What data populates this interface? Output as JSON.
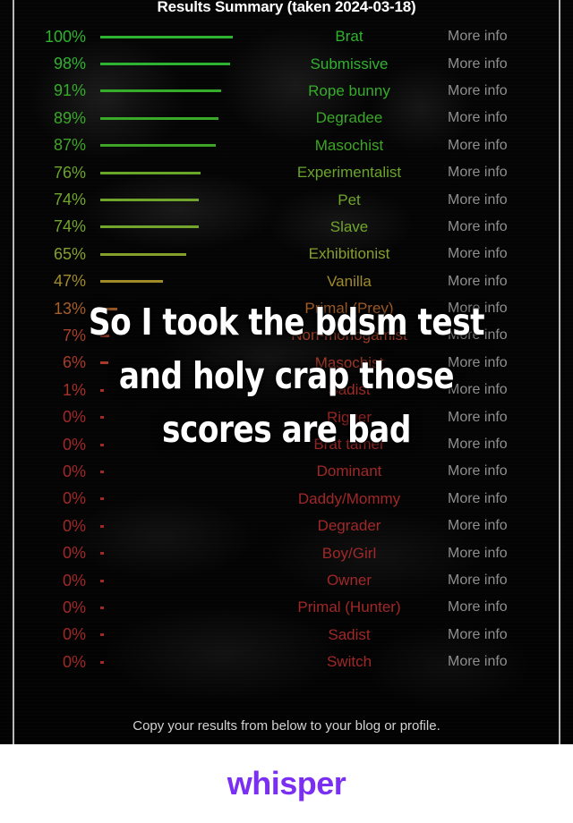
{
  "app": {
    "name": "whisper",
    "wordmark": "whisper",
    "wordmark_color": "#7a2ff2"
  },
  "results": {
    "title": "Results Summary (taken 2024-03-18)",
    "footer_note": "Copy your results from below to your blog or profile.",
    "more_info_label": "More info",
    "columns": [
      "percent",
      "bar",
      "category",
      "more_info"
    ],
    "rows": [
      {
        "percent": "100%",
        "value": 100,
        "label": "Brat",
        "color": "#2fb22f",
        "more_info": "More info"
      },
      {
        "percent": "98%",
        "value": 98,
        "label": "Submissive",
        "color": "#2fb22f",
        "more_info": "More info"
      },
      {
        "percent": "91%",
        "value": 91,
        "label": "Rope bunny",
        "color": "#35ad2a",
        "more_info": "More info"
      },
      {
        "percent": "89%",
        "value": 89,
        "label": "Degradee",
        "color": "#3aa828",
        "more_info": "More info"
      },
      {
        "percent": "87%",
        "value": 87,
        "label": "Masochist",
        "color": "#3fa526",
        "more_info": "More info"
      },
      {
        "percent": "76%",
        "value": 76,
        "label": "Experimentalist",
        "color": "#6aa52a",
        "more_info": "More info"
      },
      {
        "percent": "74%",
        "value": 74,
        "label": "Pet",
        "color": "#71a52c",
        "more_info": "More info"
      },
      {
        "percent": "74%",
        "value": 74,
        "label": "Slave",
        "color": "#71a52c",
        "more_info": "More info"
      },
      {
        "percent": "65%",
        "value": 65,
        "label": "Exhibitionist",
        "color": "#86a02d",
        "more_info": "More info"
      },
      {
        "percent": "47%",
        "value": 47,
        "label": "Vanilla",
        "color": "#a08b2b",
        "more_info": "More info"
      },
      {
        "percent": "13%",
        "value": 13,
        "label": "Primal (Prey)",
        "color": "#a85f28",
        "more_info": "More info"
      },
      {
        "percent": "7%",
        "value": 7,
        "label": "Non-monogamist",
        "color": "#a8402a",
        "more_info": "More info"
      },
      {
        "percent": "6%",
        "value": 6,
        "label": "Masochist",
        "color": "#a83a2a",
        "more_info": "More info"
      },
      {
        "percent": "1%",
        "value": 1,
        "label": "Sadist",
        "color": "#a8302a",
        "more_info": "More info"
      },
      {
        "percent": "0%",
        "value": 0,
        "label": "Rigger",
        "color": "#a02828",
        "more_info": "More info"
      },
      {
        "percent": "0%",
        "value": 0,
        "label": "Brat tamer",
        "color": "#a02828",
        "more_info": "More info"
      },
      {
        "percent": "0%",
        "value": 0,
        "label": "Dominant",
        "color": "#a02828",
        "more_info": "More info"
      },
      {
        "percent": "0%",
        "value": 0,
        "label": "Daddy/Mommy",
        "color": "#a02828",
        "more_info": "More info"
      },
      {
        "percent": "0%",
        "value": 0,
        "label": "Degrader",
        "color": "#a02828",
        "more_info": "More info"
      },
      {
        "percent": "0%",
        "value": 0,
        "label": "Boy/Girl",
        "color": "#a02828",
        "more_info": "More info"
      },
      {
        "percent": "0%",
        "value": 0,
        "label": "Owner",
        "color": "#a02828",
        "more_info": "More info"
      },
      {
        "percent": "0%",
        "value": 0,
        "label": "Primal (Hunter)",
        "color": "#a02828",
        "more_info": "More info"
      },
      {
        "percent": "0%",
        "value": 0,
        "label": "Sadist",
        "color": "#a02828",
        "more_info": "More info"
      },
      {
        "percent": "0%",
        "value": 0,
        "label": "Switch",
        "color": "#a02828",
        "more_info": "More info"
      }
    ]
  },
  "caption": {
    "lines": [
      "So I took the bdsm test",
      "and holy crap those",
      "scores are bad"
    ]
  }
}
